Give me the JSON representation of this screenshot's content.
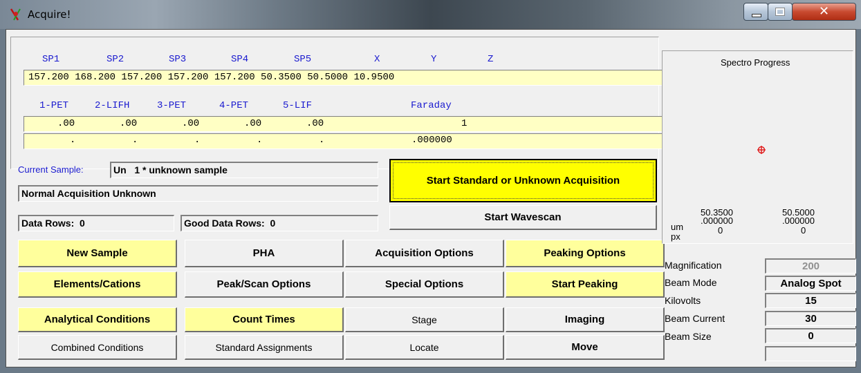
{
  "window": {
    "title": "Acquire!"
  },
  "spectrometers": {
    "headers": [
      "SP1",
      "SP2",
      "SP3",
      "SP4",
      "SP5",
      "X",
      "Y",
      "Z"
    ],
    "positions": "157.200 168.200 157.200 157.200 157.200 50.3500 50.5000 10.9500",
    "crystals": [
      "1-PET",
      "2-LIFH",
      "3-PET",
      "4-PET",
      "5-LIF"
    ],
    "faraday_label": "Faraday",
    "row2_values": [
      ".00",
      ".00",
      ".00",
      ".00",
      ".00"
    ],
    "row2_faraday": "1",
    "row3_values": [
      ".",
      ".",
      ".",
      ".",
      "."
    ],
    "row3_faraday": ".000000"
  },
  "sample": {
    "current_label": "Current Sample:",
    "current_value": "Un   1 * unknown sample",
    "mode_value": "Normal Acquisition Unknown",
    "data_rows": "Data Rows:  0",
    "good_data_rows": "Good Data Rows:  0"
  },
  "acquisition": {
    "start_label": "Start Standard or Unknown Acquisition",
    "wavescan_label": "Start Wavescan"
  },
  "buttons": {
    "new_sample": "New Sample",
    "elements_cations": "Elements/Cations",
    "analytical_conditions": "Analytical Conditions",
    "combined_conditions": "Combined Conditions",
    "pha": "PHA",
    "peak_scan_options": "Peak/Scan Options",
    "count_times": "Count Times",
    "standard_assignments": "Standard Assignments",
    "acquisition_options": "Acquisition Options",
    "special_options": "Special Options",
    "stage": "Stage",
    "locate": "Locate",
    "peaking_options": "Peaking Options",
    "start_peaking": "Start Peaking",
    "imaging": "Imaging",
    "move": "Move"
  },
  "spectro_progress": {
    "title": "Spectro Progress",
    "x_um": "50.3500",
    "y_um": "50.5000",
    "x_um2": ".000000",
    "y_um2": ".000000",
    "um_label": "um",
    "px_label": "px",
    "x_px": "0",
    "y_px": "0"
  },
  "beam": {
    "magnification_label": "Magnification",
    "magnification_value": "200",
    "beam_mode_label": "Beam Mode",
    "beam_mode_value": "Analog  Spot",
    "kilovolts_label": "Kilovolts",
    "kilovolts_value": "15",
    "beam_current_label": "Beam Current",
    "beam_current_value": "30",
    "beam_size_label": "Beam Size",
    "beam_size_value": "0",
    "extra_value": ""
  },
  "colors": {
    "header_blue": "#1a1acf",
    "field_yellow": "#ffffc4",
    "button_yellow": "#ffff9c",
    "target_red": "#e02020"
  }
}
